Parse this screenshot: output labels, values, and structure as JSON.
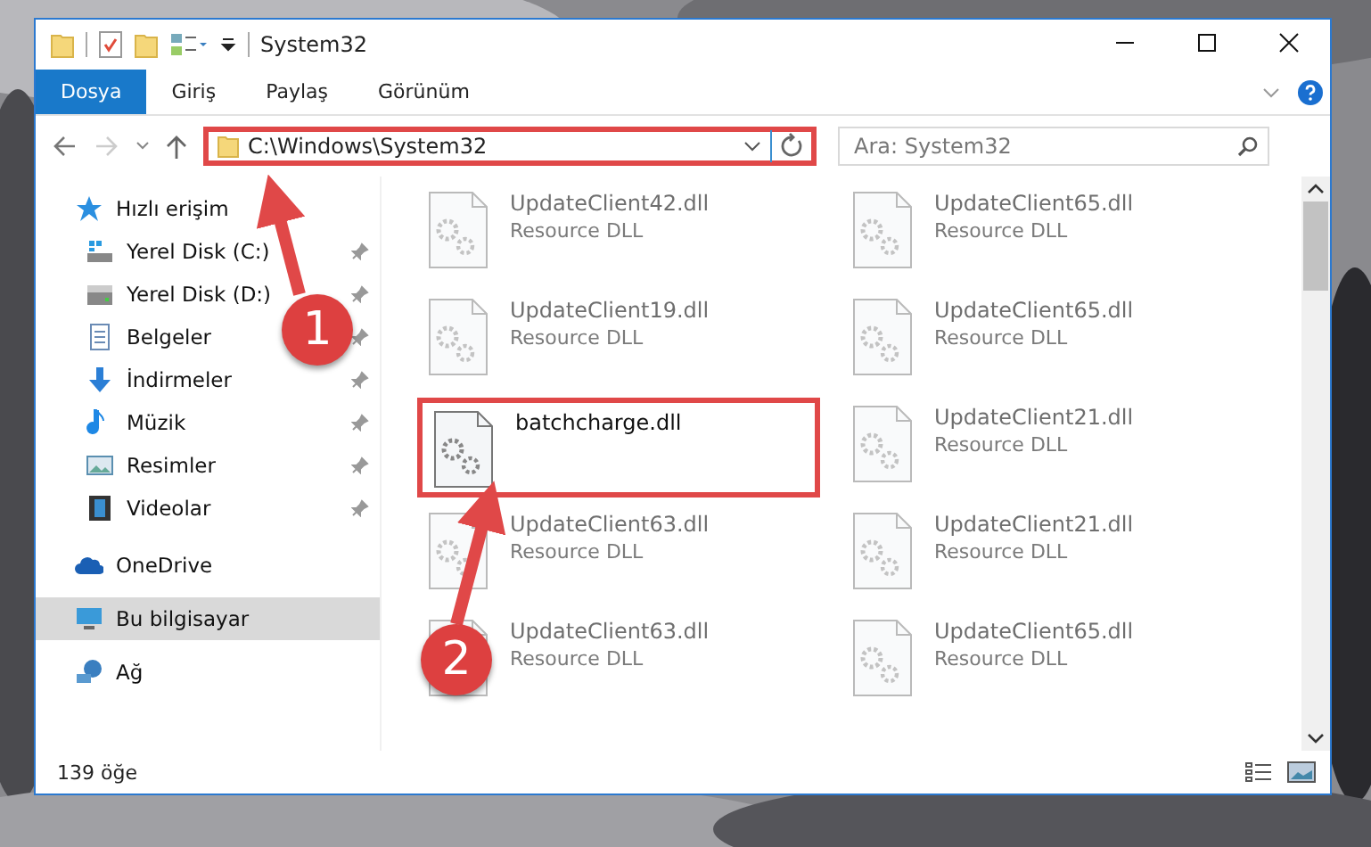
{
  "window": {
    "title": "System32"
  },
  "ribbon_tabs": [
    {
      "label": "Dosya",
      "selected": true
    },
    {
      "label": "Giriş",
      "selected": false
    },
    {
      "label": "Paylaş",
      "selected": false
    },
    {
      "label": "Görünüm",
      "selected": false
    }
  ],
  "address_bar": {
    "path": "C:\\Windows\\System32",
    "highlighted": true
  },
  "search": {
    "placeholder": "Ara: System32"
  },
  "sidebar": {
    "items": [
      {
        "label": "Hızlı erişim",
        "kind": "quick",
        "selected": false,
        "pinned": false,
        "children": [
          {
            "label": "Yerel Disk (C:)",
            "kind": "disk-c",
            "selected": false,
            "pinned": true
          },
          {
            "label": "Yerel Disk (D:)",
            "kind": "disk",
            "selected": false,
            "pinned": true
          },
          {
            "label": "Belgeler",
            "kind": "docs",
            "selected": false,
            "pinned": true
          },
          {
            "label": "İndirmeler",
            "kind": "download",
            "selected": false,
            "pinned": true
          },
          {
            "label": "Müzik",
            "kind": "music",
            "selected": false,
            "pinned": true
          },
          {
            "label": "Resimler",
            "kind": "pictures",
            "selected": false,
            "pinned": true
          },
          {
            "label": "Videolar",
            "kind": "videos",
            "selected": false,
            "pinned": true
          }
        ]
      },
      {
        "label": "OneDrive",
        "kind": "cloud",
        "selected": false,
        "pinned": false
      },
      {
        "label": "Bu bilgisayar",
        "kind": "pc",
        "selected": true,
        "pinned": false
      },
      {
        "label": "Ağ",
        "kind": "network",
        "selected": false,
        "pinned": false
      }
    ]
  },
  "files": [
    {
      "name": "UpdateClient42.dll",
      "type": "Resource DLL",
      "blurred": true,
      "highlighted": false
    },
    {
      "name": "UpdateClient65.dll",
      "type": "Resource DLL",
      "blurred": true,
      "highlighted": false
    },
    {
      "name": "UpdateClient19.dll",
      "type": "Resource DLL",
      "blurred": true,
      "highlighted": false
    },
    {
      "name": "UpdateClient65.dll",
      "type": "Resource DLL",
      "blurred": true,
      "highlighted": false
    },
    {
      "name": "batchcharge.dll",
      "blurred": false,
      "highlighted": true
    },
    {
      "name": "UpdateClient21.dll",
      "type": "Resource DLL",
      "blurred": true,
      "highlighted": false
    },
    {
      "name": "UpdateClient63.dll",
      "type": "Resource DLL",
      "blurred": true,
      "highlighted": false
    },
    {
      "name": "UpdateClient21.dll",
      "type": "Resource DLL",
      "blurred": true,
      "highlighted": false
    },
    {
      "name": "UpdateClient63.dll",
      "type": "Resource DLL",
      "blurred": true,
      "highlighted": false
    },
    {
      "name": "UpdateClient65.dll",
      "type": "Resource DLL",
      "blurred": true,
      "highlighted": false
    }
  ],
  "status_bar": {
    "item_count": "139 öğe"
  },
  "callouts": [
    {
      "label": "1"
    },
    {
      "label": "2"
    }
  ]
}
